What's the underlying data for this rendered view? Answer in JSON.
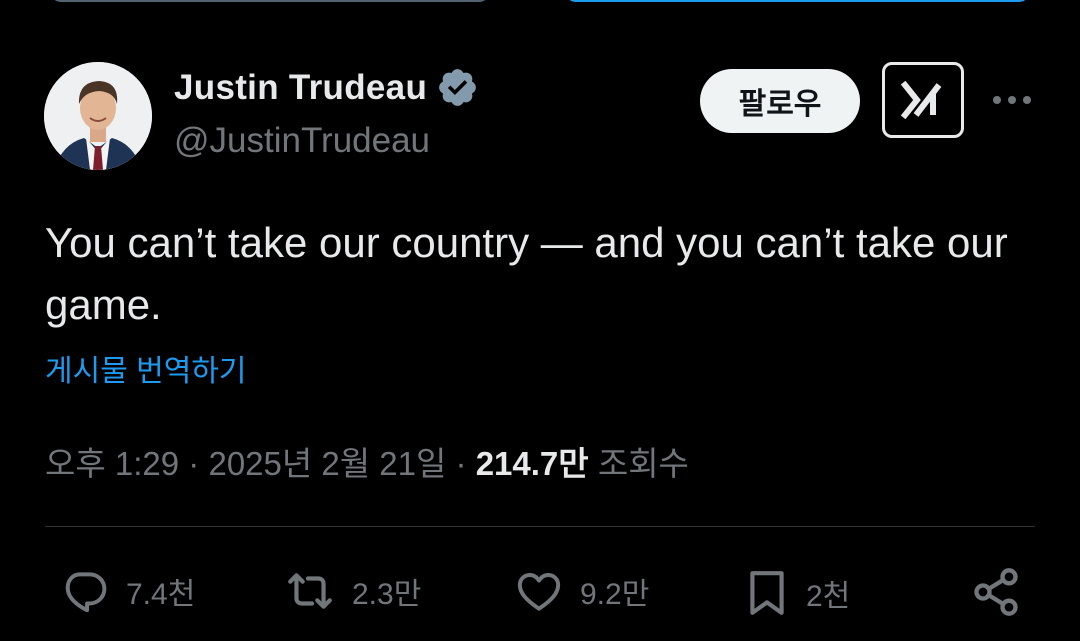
{
  "tweet": {
    "author": {
      "display_name": "Justin Trudeau",
      "handle": "@JustinTrudeau",
      "verified": true
    },
    "follow_label": "팔로우",
    "text": "You can’t take our country — and you can’t take our game.",
    "translate_label": "게시물 번역하기",
    "meta": {
      "time": "오후 1:29",
      "separator": "·",
      "date": "2025년 2월 21일",
      "views_count": "214.7만",
      "views_label": "조회수"
    },
    "actions": {
      "replies": "7.4천",
      "reposts": "2.3만",
      "likes": "9.2만",
      "bookmarks": "2천"
    }
  },
  "colors": {
    "background": "#000000",
    "text": "#e7e9ea",
    "secondary_text": "#71767b",
    "accent": "#1d9bf0",
    "divider": "#2f3336"
  },
  "icons": [
    "verified-badge-icon",
    "grok-icon",
    "more-icon",
    "reply-icon",
    "repost-icon",
    "like-icon",
    "bookmark-icon",
    "share-icon"
  ]
}
